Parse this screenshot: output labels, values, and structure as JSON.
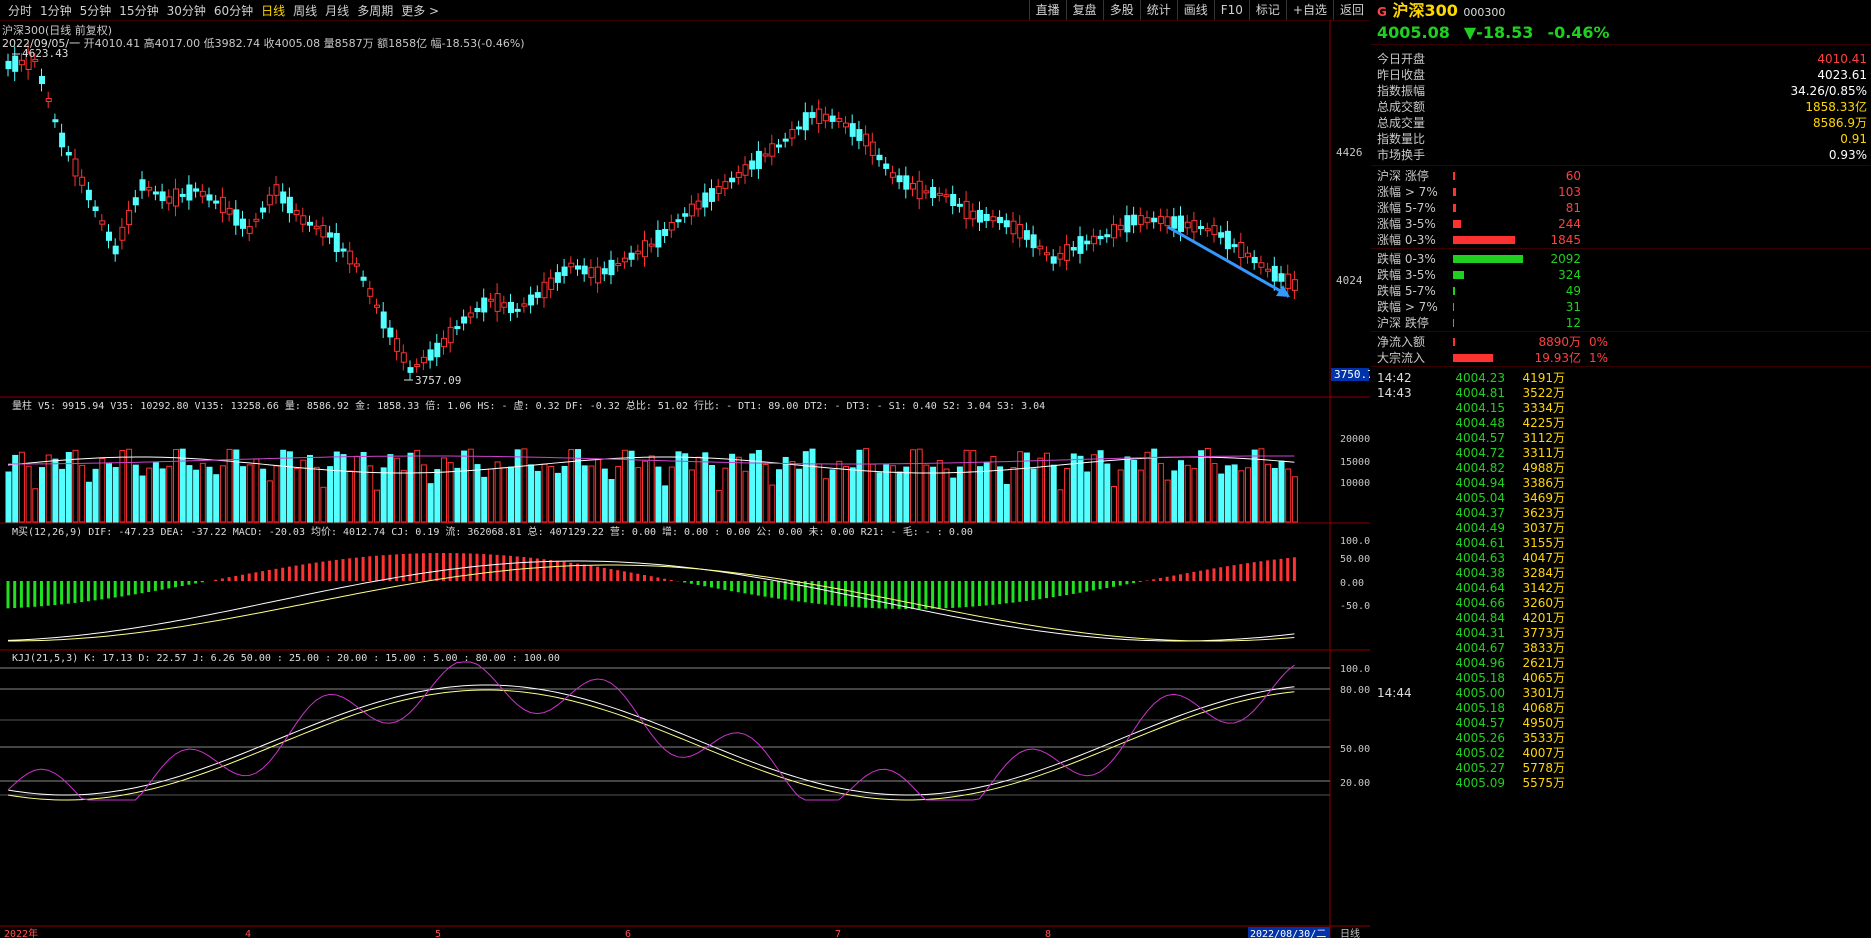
{
  "toolbar": {
    "timeframes": [
      "分时",
      "1分钟",
      "5分钟",
      "15分钟",
      "30分钟",
      "60分钟",
      "日线",
      "周线",
      "月线",
      "多周期",
      "更多 >"
    ],
    "active": "日线",
    "tools": [
      "直播",
      "复盘",
      "多股",
      "统计",
      "画线",
      "F10",
      "标记",
      "+自选",
      "返回"
    ]
  },
  "chart": {
    "title": "沪深300(日线 前复权)",
    "info": {
      "date": "2022/09/05/一",
      "open": "开4010.41",
      "high": "高4017.00",
      "low": "低3982.74",
      "close": "收4005.08",
      "vol": "量8587万",
      "amt": "额1858亿",
      "chg": "幅-18.53(-0.46%)"
    },
    "max_label": "4623.43",
    "min_label": "3757.09",
    "price_ticks": [
      "4426",
      "4024"
    ],
    "current_price_tag": "3750.7",
    "x_labels": [
      "2022年",
      "4",
      "5",
      "6",
      "7",
      "8",
      "2022/08/30/二",
      "日线"
    ]
  },
  "volume": {
    "indicator_line": "量柱  V5: 9915.94  V35: 10292.80  V135: 13258.66  量: 8586.92  金: 1858.33  倍: 1.06  HS: - 虚: 0.32  DF: -0.32  总比: 51.02  行比: - DT1: 89.00  DT2: - DT3: - S1: 0.40  S2: 3.04  S3: 3.04",
    "ticks": [
      "20000",
      "15000",
      "10000"
    ]
  },
  "macd": {
    "indicator_line": "M买(12,26,9)  DIF: -47.23  DEA: -37.22  MACD: -20.03  均价: 4012.74  CJ: 0.19  流: 362068.81  总: 407129.22  营: 0.00  增: 0.00 : 0.00  公: 0.00  未: 0.00  R21: - 毛: - : 0.00",
    "ticks": [
      "100.0",
      "50.00",
      "0.00",
      "-50.00"
    ]
  },
  "kdj": {
    "indicator_line": "KJJ(21,5,3)  K: 17.13  D: 22.57  J: 6.26  50.00 : 25.00 : 20.00 : 15.00 : 5.00 : 80.00 : 100.00",
    "ticks": [
      "100.00",
      "80.00",
      "50.00",
      "20.00"
    ]
  },
  "quote": {
    "code_prefix": "G",
    "name": "沪深300",
    "code": "000300",
    "price": "4005.08",
    "change": "▼-18.53",
    "pct": "-0.46%",
    "stats": [
      [
        "今日开盘",
        "4010.41"
      ],
      [
        "昨日收盘",
        "4023.61"
      ],
      [
        "指数振幅",
        "34.26/0.85%"
      ],
      [
        "总成交额",
        "1858.33亿"
      ],
      [
        "总成交量",
        "8586.9万"
      ],
      [
        "指数量比",
        "0.91"
      ],
      [
        "市场换手",
        "0.93%"
      ]
    ],
    "breadth_up": [
      [
        "沪深 涨停",
        "60"
      ],
      [
        "涨幅 > 7%",
        "103"
      ],
      [
        "涨幅 5-7%",
        "81"
      ],
      [
        "涨幅 3-5%",
        "244"
      ],
      [
        "涨幅 0-3%",
        "1845"
      ]
    ],
    "breadth_down": [
      [
        "跌幅 0-3%",
        "2092"
      ],
      [
        "跌幅 3-5%",
        "324"
      ],
      [
        "跌幅 5-7%",
        "49"
      ],
      [
        "跌幅 > 7%",
        "31"
      ],
      [
        "沪深 跌停",
        "12"
      ]
    ],
    "flow": [
      [
        "净流入额",
        "8890万",
        "0%"
      ],
      [
        "大宗流入",
        "19.93亿",
        "1%"
      ]
    ],
    "ticks": [
      [
        "14:42",
        "4004.23",
        "4191万"
      ],
      [
        "14:43",
        "4004.81",
        "3522万"
      ],
      [
        "",
        "4004.15",
        "3334万"
      ],
      [
        "",
        "4004.48",
        "4225万"
      ],
      [
        "",
        "4004.57",
        "3112万"
      ],
      [
        "",
        "4004.72",
        "3311万"
      ],
      [
        "",
        "4004.82",
        "4988万"
      ],
      [
        "",
        "4004.94",
        "3386万"
      ],
      [
        "",
        "4005.04",
        "3469万"
      ],
      [
        "",
        "4004.37",
        "3623万"
      ],
      [
        "",
        "4004.49",
        "3037万"
      ],
      [
        "",
        "4004.61",
        "3155万"
      ],
      [
        "",
        "4004.63",
        "4047万"
      ],
      [
        "",
        "4004.38",
        "3284万"
      ],
      [
        "",
        "4004.64",
        "3142万"
      ],
      [
        "",
        "4004.66",
        "3260万"
      ],
      [
        "",
        "4004.84",
        "4201万"
      ],
      [
        "",
        "4004.31",
        "3773万"
      ],
      [
        "",
        "4004.67",
        "3833万"
      ],
      [
        "",
        "4004.96",
        "2621万"
      ],
      [
        "",
        "4005.18",
        "4065万"
      ],
      [
        "14:44",
        "4005.00",
        "3301万"
      ],
      [
        "",
        "4005.18",
        "4068万"
      ],
      [
        "",
        "4004.57",
        "4950万"
      ],
      [
        "",
        "4005.26",
        "3533万"
      ],
      [
        "",
        "4005.02",
        "4007万"
      ],
      [
        "",
        "4005.27",
        "5778万"
      ],
      [
        "",
        "4005.09",
        "5575万"
      ]
    ]
  },
  "colors": {
    "up": "#ff3232",
    "down": "#54ffff",
    "bg": "#000000",
    "accent": "#ffd700",
    "green": "#20d020"
  }
}
